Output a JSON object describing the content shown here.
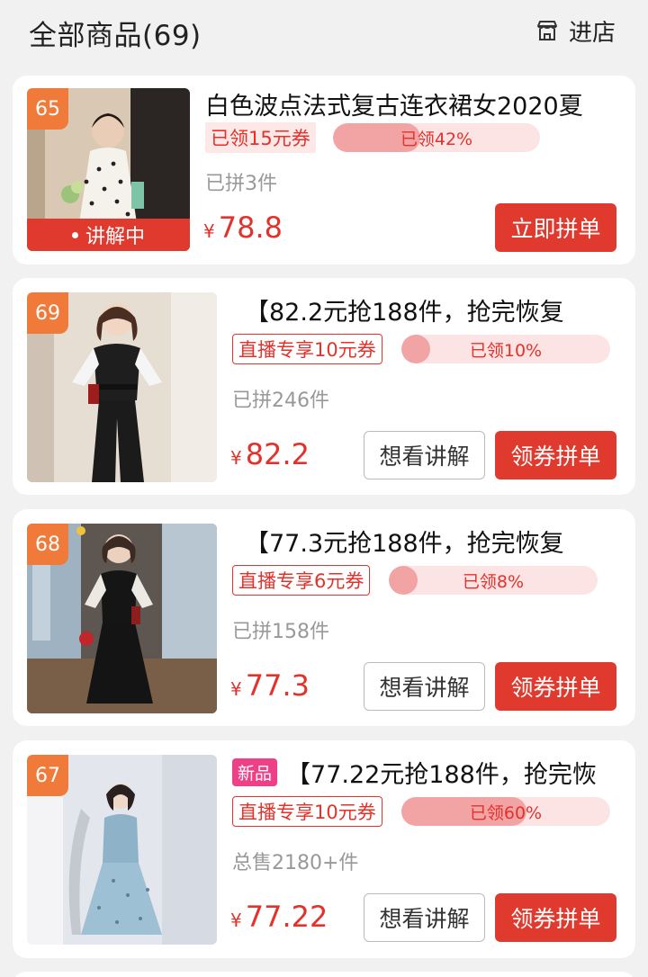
{
  "header": {
    "title": "全部商品(69)",
    "enter_shop_label": "进店",
    "enter_shop_icon": "store-icon"
  },
  "colors": {
    "accent_red": "#e03a2f",
    "rank_orange": "#f07a3a",
    "new_tag_pink": "#ef3f86"
  },
  "products": [
    {
      "rank": "65",
      "title": "白色波点法式复古连衣裙女2020夏",
      "coupon": "已领15元券",
      "progress_label": "已领42%",
      "progress_percent": 42,
      "sold": "已拼3件",
      "price_symbol": "¥",
      "price": "78.8",
      "live_label": "讲解中",
      "primary_button": "立即拼单"
    },
    {
      "rank": "69",
      "title": "【82.2元抢188件，抢完恢复",
      "coupon": "直播专享10元券",
      "progress_label": "已领10%",
      "progress_percent": 10,
      "sold": "已拼246件",
      "price_symbol": "¥",
      "price": "82.2",
      "secondary_button": "想看讲解",
      "primary_button": "领券拼单"
    },
    {
      "rank": "68",
      "title": "【77.3元抢188件，抢完恢复",
      "coupon": "直播专享6元券",
      "progress_label": "已领8%",
      "progress_percent": 8,
      "sold": "已拼158件",
      "price_symbol": "¥",
      "price": "77.3",
      "secondary_button": "想看讲解",
      "primary_button": "领券拼单"
    },
    {
      "rank": "67",
      "tag": "新品",
      "title": "【77.22元抢188件，抢完恢",
      "coupon": "直播专享10元券",
      "progress_label": "已领60%",
      "progress_percent": 60,
      "sold": "总售2180+件",
      "price_symbol": "¥",
      "price": "77.22",
      "secondary_button": "想看讲解",
      "primary_button": "领券拼单"
    }
  ]
}
